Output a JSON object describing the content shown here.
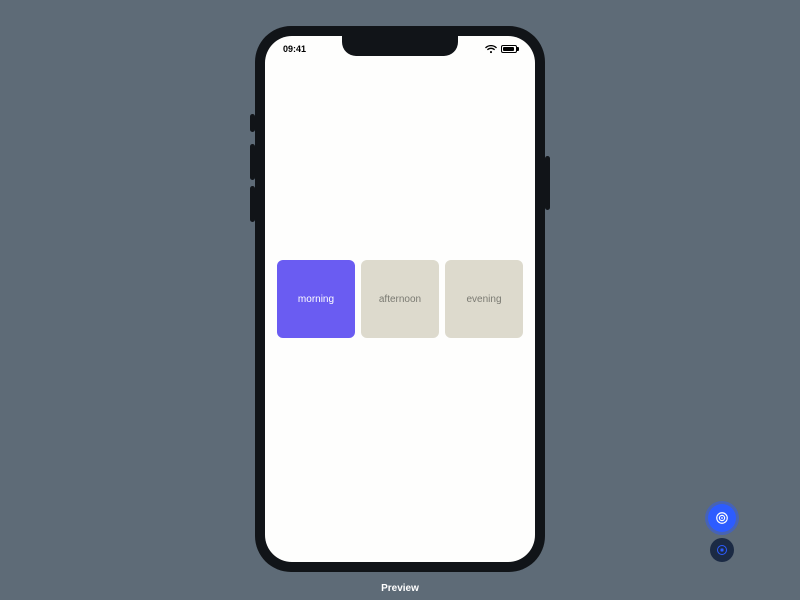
{
  "status_bar": {
    "time": "09:41"
  },
  "options": [
    {
      "label": "morning",
      "selected": true
    },
    {
      "label": "afternoon",
      "selected": false
    },
    {
      "label": "evening",
      "selected": false
    }
  ],
  "caption": "Preview",
  "colors": {
    "background": "#5e6b77",
    "accent": "#6a5cf2",
    "tile_bg": "#dddacd",
    "tile_text": "#7a7a72",
    "fab_primary": "#2d5cff",
    "fab_secondary": "#1b2a44"
  }
}
